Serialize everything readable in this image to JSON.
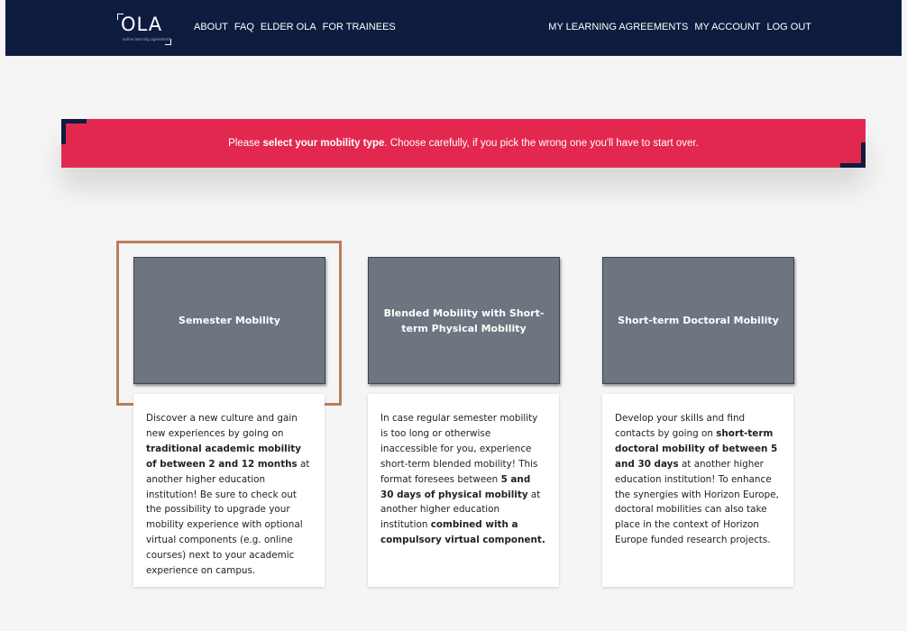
{
  "navbar": {
    "logo_text": "OLA",
    "logo_subtext": "online learning agreement",
    "left_links": [
      "ABOUT",
      "FAQ",
      "ELDER OLA",
      "FOR TRAINEES"
    ],
    "right_links": [
      "MY LEARNING AGREEMENTS",
      "MY ACCOUNT",
      "LOG OUT"
    ]
  },
  "alert": {
    "prefix": "Please ",
    "bold": "select your mobility type",
    "suffix": ". Choose carefully, if you pick the wrong one you'll have to start over."
  },
  "cards": [
    {
      "title": "Semester Mobility",
      "selected": true,
      "description": [
        {
          "t": "Discover a new culture and gain new experiences by going on ",
          "b": false
        },
        {
          "t": "traditional academic mobility of between 2 and 12 months",
          "b": true
        },
        {
          "t": " at another higher education institution! Be sure to check out the possibility to upgrade your mobility experience with optional virtual components (e.g. online courses) next to your academic experience on campus.",
          "b": false
        }
      ]
    },
    {
      "title": "Blended Mobility with Short-term Physical Mobility",
      "selected": false,
      "description": [
        {
          "t": "In case regular semester mobility is too long or otherwise inaccessible for you, experience short-term blended mobility! This format foresees between ",
          "b": false
        },
        {
          "t": "5 and 30 days of physical mobility",
          "b": true
        },
        {
          "t": " at another higher education institution ",
          "b": false
        },
        {
          "t": "combined with a compulsory virtual component.",
          "b": true
        }
      ]
    },
    {
      "title": "Short-term Doctoral Mobility",
      "selected": false,
      "description": [
        {
          "t": "Develop your skills and find contacts by going on ",
          "b": false
        },
        {
          "t": "short-term doctoral mobility of between 5 and 30 days",
          "b": true
        },
        {
          "t": " at another higher education institution! To enhance the synergies with Horizon Europe, doctoral mobilities can also take place in the context of Horizon Europe funded research projects.",
          "b": false
        }
      ]
    }
  ],
  "colors": {
    "navbar": "#0e1c3f",
    "alert": "#e3284f",
    "card_tile": "#6d7580",
    "selection_border": "#b87f5a"
  }
}
